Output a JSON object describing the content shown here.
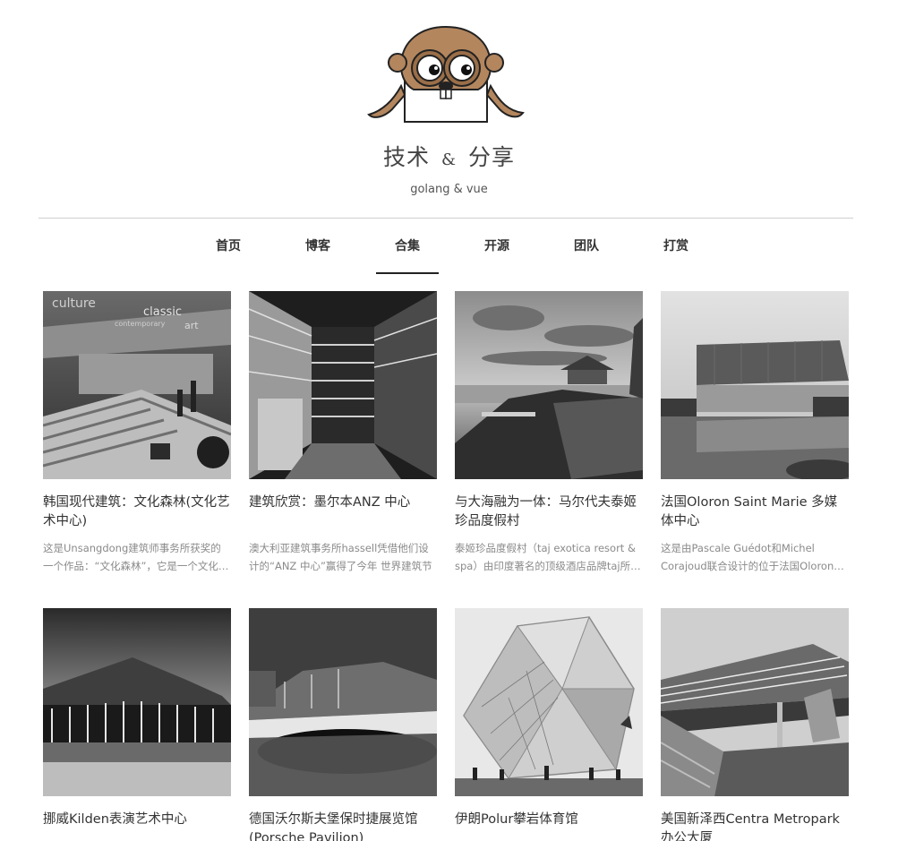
{
  "site": {
    "title_part1": "技术",
    "title_amp": "&",
    "title_part2": "分享",
    "subtitle": "golang & vue",
    "logo_icon": "gopher-mascot-icon"
  },
  "nav": {
    "items": [
      {
        "label": "首页",
        "active": false
      },
      {
        "label": "博客",
        "active": false
      },
      {
        "label": "合集",
        "active": true
      },
      {
        "label": "开源",
        "active": false
      },
      {
        "label": "团队",
        "active": false
      },
      {
        "label": "打赏",
        "active": false
      }
    ]
  },
  "cards": [
    {
      "title": "韩国现代建筑：文化森林(文化艺术中心)",
      "excerpt": "这是Unsangdong建筑师事务所获奖的一个作品：“文化森林”，它是一个文化艺术中心",
      "image_icon": "building-photo-icon",
      "image_signs": [
        "culture",
        "classic",
        "contemporary",
        "art"
      ]
    },
    {
      "title": "建筑欣赏：墨尔本ANZ 中心",
      "excerpt": "澳大利亚建筑事务所hassell凭借他们设计的“ANZ 中心”赢得了今年 世界建筑节",
      "image_icon": "building-photo-icon"
    },
    {
      "title": "与大海融为一体：马尔代夫泰姬珍品度假村",
      "excerpt": "泰姬珍品度假村（taj exotica resort & spa）由印度著名的顶级酒店品牌taj所经营",
      "image_icon": "building-photo-icon"
    },
    {
      "title": "法国Oloron Saint Marie 多媒体中心",
      "excerpt": "这是由Pascale Guédot和Michel Corajoud联合设计的位于法国Oloron Saint Marie的多媒体中心",
      "image_icon": "building-photo-icon"
    },
    {
      "title": "挪威Kilden表演艺术中心",
      "excerpt": "",
      "image_icon": "building-photo-icon"
    },
    {
      "title": "德国沃尔斯夫堡保时捷展览馆(Porsche Pavilion)",
      "excerpt": "",
      "image_icon": "building-photo-icon"
    },
    {
      "title": "伊朗Polur攀岩体育馆",
      "excerpt": "",
      "image_icon": "building-photo-icon"
    },
    {
      "title": "美国新泽西Centra Metropark办公大厦",
      "excerpt": "",
      "image_icon": "building-photo-icon"
    }
  ]
}
